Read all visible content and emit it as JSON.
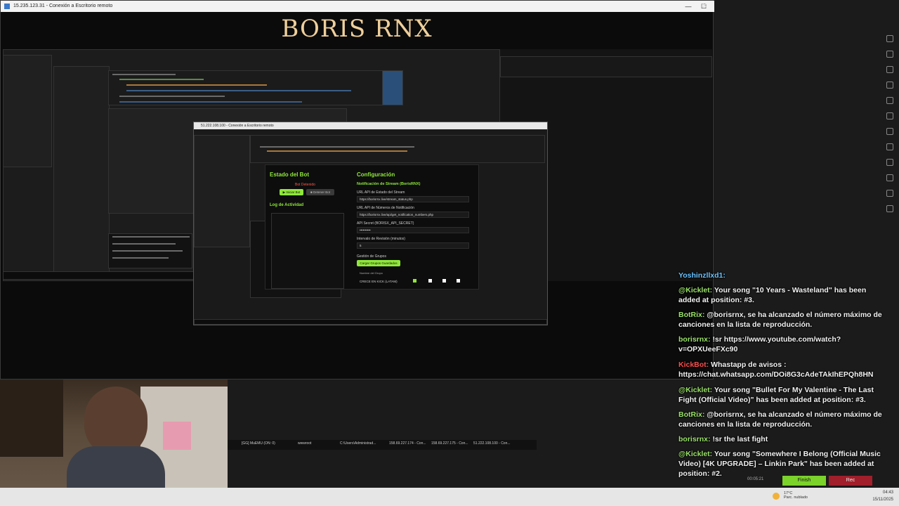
{
  "outer_window": {
    "title": "15.235.123.31 - Conexión a Escritorio remoto",
    "controls": [
      "—",
      "☐",
      "✕"
    ]
  },
  "brand": {
    "text": "BORIS RNX"
  },
  "inner_window": {
    "title": "51.222.108.100 - Conexión a Escritorio remoto"
  },
  "bot_app": {
    "status_title": "Estado del Bot",
    "status_value": "Bot Detenido",
    "start_button": "▶ Iniciar Bot",
    "stop_button": "■ Detener Bot",
    "log_title": "Log de Actividad",
    "config_title": "Configuración",
    "notif_title": "Notificación de Stream (BorisRNX)",
    "stream_url_label": "URL API de Estado del Stream",
    "stream_url_value": "https://borisrnx.live/stream_status.php",
    "numbers_url_label": "URL API de Números de Notificación",
    "numbers_url_value": "https://borisrnx.live/api/get_notification_numbers.php",
    "secret_label": "API Secret (BORISX_API_SECRET)",
    "secret_value": "••••••••••",
    "interval_label": "Intervalo de Revisión (minutos)",
    "interval_value": "5",
    "groups_label": "Gestión de Grupos",
    "load_groups_button": "Cargar Grupos Guardados",
    "group_name": "CRECE EN KICK (LATAM)",
    "group_column": "Nombre del Grupo"
  },
  "chat": {
    "messages": [
      {
        "user": "Yoshinzllxd1:",
        "text": "",
        "color": "blue"
      },
      {
        "user": "@Kicklet:",
        "text": "Your song \"10 Years - Wasteland\" has been added at position: #3.",
        "color": "green"
      },
      {
        "user": "BotRix:",
        "text": "@borisrnx, se ha alcanzado el número máximo de canciones en la lista de reproducción.",
        "color": "green"
      },
      {
        "user": "borisrnx:",
        "text": "!sr https://www.youtube.com/watch?v=OPXUeeFXc90",
        "color": "green"
      },
      {
        "user": "KickBot:",
        "text": "Whastapp de avisos : https://chat.whatsapp.com/DOi8G3cAdeTAkIhEPQh8HN",
        "color": "red"
      },
      {
        "user": "@Kicklet:",
        "text": "Your song \"Bullet For My Valentine - The Last Fight (Official Video)\" has been added at position: #3.",
        "color": "green"
      },
      {
        "user": "BotRix:",
        "text": "@borisrnx, se ha alcanzado el número máximo de canciones en la lista de reproducción.",
        "color": "green"
      },
      {
        "user": "borisrnx:",
        "text": "!sr the last fight",
        "color": "green"
      },
      {
        "user": "@Kicklet:",
        "text": "Your song \"Somewhere I Belong (Official Music Video) [4K UPGRADE] – Linkin Park\" has been added at position: #2.",
        "color": "green"
      }
    ]
  },
  "stream_controls": {
    "finish": "Finish",
    "rec": "Rec",
    "timer": "00:05:21"
  },
  "remote_taskbar": {
    "items": [
      "[GG] MuEMU (ON: 0)",
      "wwwroot",
      "C:\\Users\\Administrad...",
      "158.69.227.174 - Con...",
      "158.69.227.175 - Con...",
      "51.222.108.100 - Con..."
    ]
  },
  "system_tray": {
    "weather_temp": "17°C",
    "weather_desc": "Parc. nublado",
    "time": "04:43",
    "date": "15/11/2025"
  },
  "colors": {
    "brand": "#efcf9b",
    "accent_green": "#8fe83a",
    "rec_red": "#a11f2a"
  }
}
